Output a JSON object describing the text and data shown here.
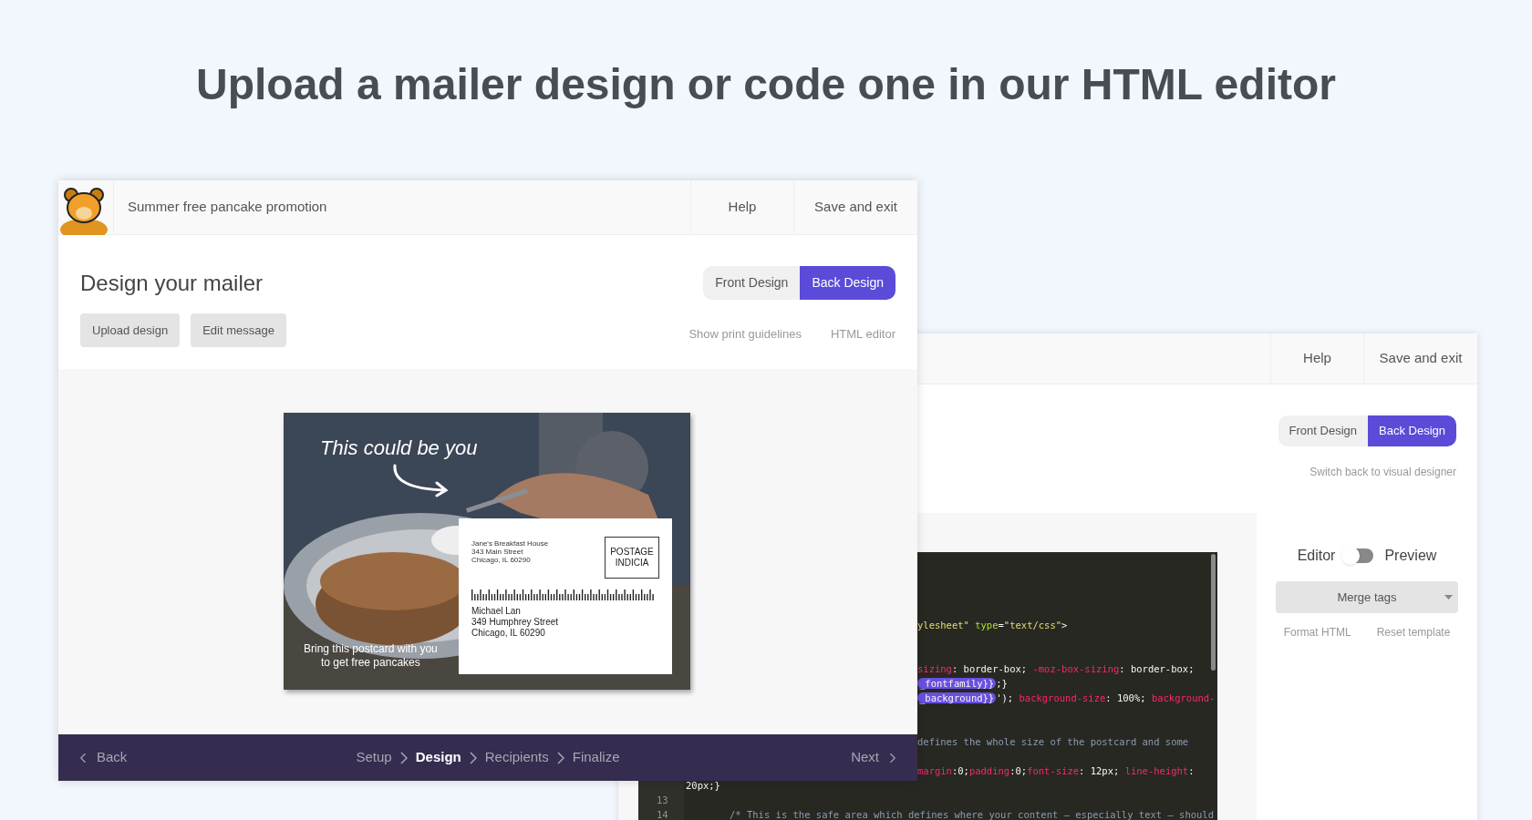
{
  "headline": "Upload a mailer design or code one in our HTML editor",
  "back_window": {
    "header_links": [
      "Help",
      "Save and exit"
    ],
    "design_tabs": [
      {
        "label": "Front Design",
        "selected": false
      },
      {
        "label": "Back Design",
        "selected": true
      }
    ],
    "switch_link": "Switch back to visual designer",
    "editor_toggle": {
      "left": "Editor",
      "right": "Preview",
      "on": false
    },
    "merge_tags": "Merge tags",
    "actions": [
      "Format HTML",
      "Reset template"
    ],
    "code_lines": [
      {
        "tokens": [
          {
            "kind": "str",
            "text": "ylesheet\" "
          },
          {
            "kind": "attr",
            "text": "type"
          },
          {
            "kind": "plain",
            "text": "="
          },
          {
            "kind": "str",
            "text": "\"text/css\""
          },
          {
            "kind": "plain",
            "text": ">"
          }
        ]
      },
      {
        "tokens": [
          {
            "kind": "prop",
            "text": "sizing"
          },
          {
            "kind": "plain",
            "text": ": border-box; "
          },
          {
            "kind": "prop",
            "text": "-moz-box-sizing"
          },
          {
            "kind": "plain",
            "text": ": border-box;"
          }
        ]
      },
      {
        "tokens": [
          {
            "kind": "tag",
            "text": "_fontfamily}}"
          },
          {
            "kind": "plain",
            "text": ";}"
          }
        ]
      },
      {
        "tokens": [
          {
            "kind": "tag",
            "text": "_background}}"
          },
          {
            "kind": "plain",
            "text": "'); "
          },
          {
            "kind": "prop",
            "text": "background-size"
          },
          {
            "kind": "plain",
            "text": ": 100%; "
          },
          {
            "kind": "prop",
            "text": "background-"
          }
        ]
      },
      {
        "tokens": [
          {
            "kind": "comment",
            "text": "defines the whole size of the postcard and some"
          }
        ]
      },
      {
        "tokens": [
          {
            "kind": "prop",
            "text": "margin"
          },
          {
            "kind": "plain",
            "text": ":0;"
          },
          {
            "kind": "prop",
            "text": "padding"
          },
          {
            "kind": "plain",
            "text": ":0;"
          },
          {
            "kind": "prop",
            "text": "font-size"
          },
          {
            "kind": "plain",
            "text": ": 12px; "
          },
          {
            "kind": "prop",
            "text": "line-height"
          },
          {
            "kind": "plain",
            "text": ":"
          }
        ]
      },
      {
        "tokens": [
          {
            "kind": "plain",
            "text": "20px;}"
          }
        ]
      },
      {
        "number": "13"
      },
      {
        "number": "14",
        "tokens": [
          {
            "kind": "comment",
            "text": "/* This is the safe area which defines where your content – especially text – should"
          }
        ]
      }
    ]
  },
  "front_window": {
    "project_title": "Summer free pancake promotion",
    "header_links": [
      "Help",
      "Save and exit"
    ],
    "heading": "Design your mailer",
    "design_tabs": [
      {
        "label": "Front Design",
        "selected": false
      },
      {
        "label": "Back Design",
        "selected": true
      }
    ],
    "actions": [
      "Upload design",
      "Edit message"
    ],
    "links": [
      "Show print guidelines",
      "HTML editor"
    ],
    "postcard": {
      "headline": "This could be you",
      "footer": [
        "Bring this postcard with you",
        "to get free pancakes"
      ],
      "return_address": [
        "Jane's Breakfast House",
        "343 Main Street",
        "Chicago, IL 60290"
      ],
      "postage": [
        "POSTAGE",
        "INDICIA"
      ],
      "recipient": [
        "Michael Lan",
        "349 Humphrey Street",
        "Chicago, IL 60290"
      ]
    },
    "footer": {
      "back": "Back",
      "steps": [
        {
          "label": "Setup",
          "selected": false
        },
        {
          "label": "Design",
          "selected": true
        },
        {
          "label": "Recipients",
          "selected": false
        },
        {
          "label": "Finalize",
          "selected": false
        }
      ],
      "next": "Next"
    }
  }
}
